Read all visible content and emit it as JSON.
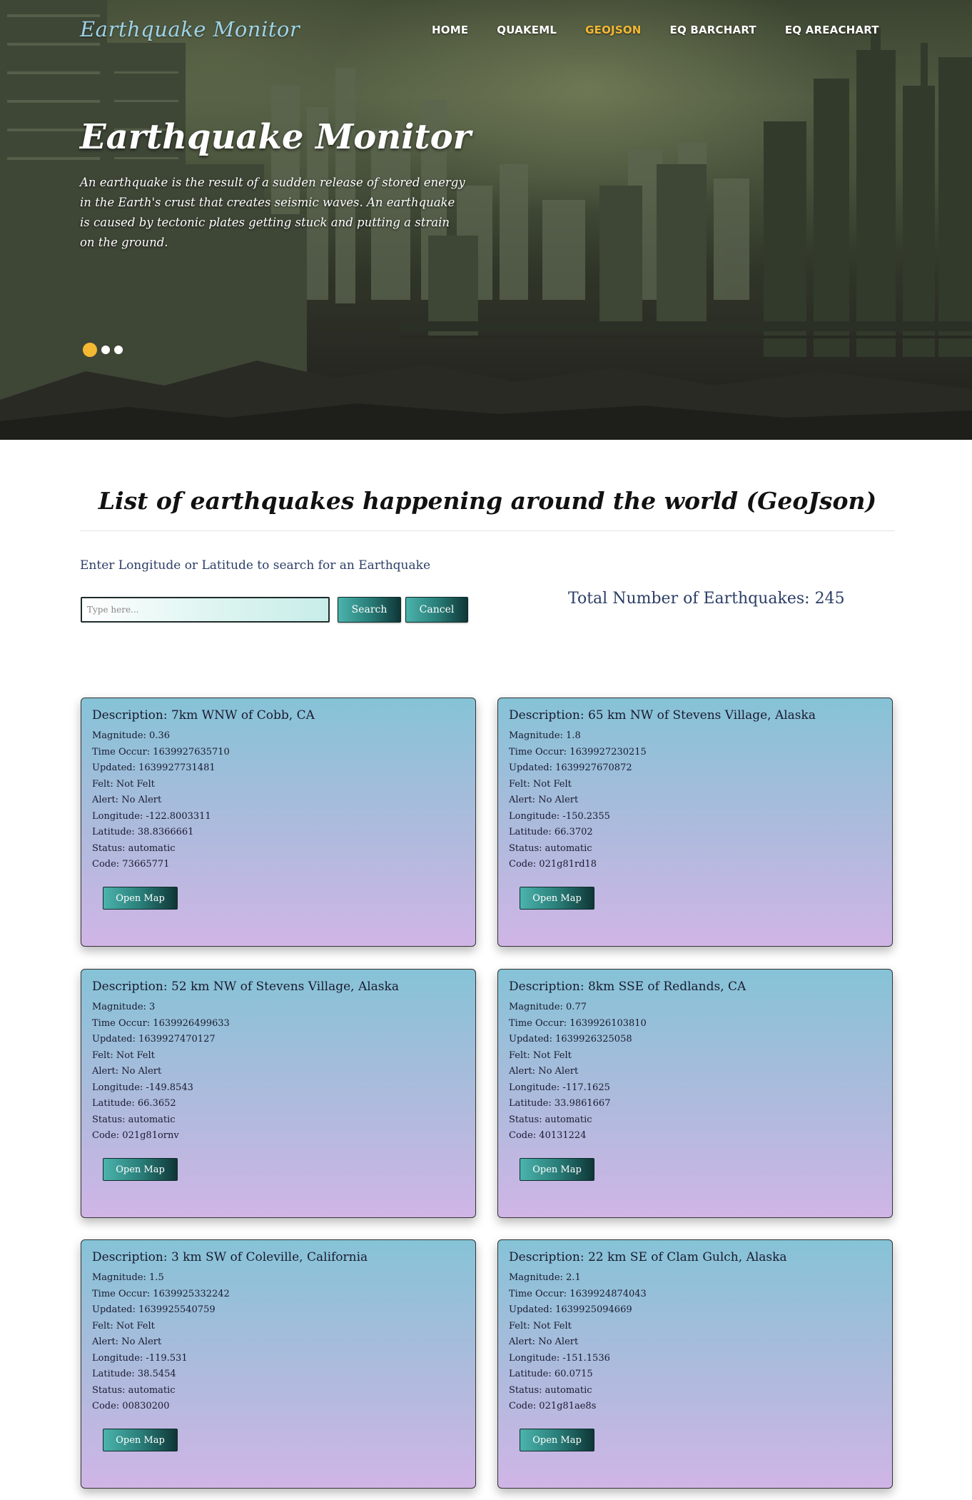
{
  "brand": "Earthquake Monitor",
  "nav": {
    "home": "HOME",
    "quakeml": "QUAKEML",
    "geojson": "GEOJSON",
    "barchart": "EQ BARCHART",
    "areachart": "EQ AREACHART"
  },
  "hero": {
    "title": "Earthquake Monitor",
    "text": "An earthquake is the result of a sudden release of stored energy in the Earth's crust that creates seismic waves. An earthquake is caused by tectonic plates getting stuck and putting a strain on the ground."
  },
  "section": {
    "title": "List of earthquakes happening around the world (GeoJson)",
    "search_hint": "Enter Longitude or Latitude to search for an Earthquake",
    "search_placeholder": "Type here...",
    "search_label": "Search",
    "cancel_label": "Cancel",
    "total": "Total Number of Earthquakes: 245"
  },
  "colors": {
    "accent": "#f5b833",
    "brand": "#9fd3e8",
    "button_start": "#4bb3ac",
    "button_end": "#0e3636"
  },
  "cards": [
    {
      "desc": "Description: 7km WNW of Cobb, CA",
      "rows": [
        "Magnitude: 0.36",
        "Time Occur: 1639927635710",
        "Updated: 1639927731481",
        "Felt: Not Felt",
        "Alert: No Alert",
        "Longitude: -122.8003311",
        "Latitude: 38.8366661",
        "Status: automatic",
        "Code: 73665771"
      ],
      "button": "Open Map"
    },
    {
      "desc": "Description: 65 km NW of Stevens Village, Alaska",
      "rows": [
        "Magnitude: 1.8",
        "Time Occur: 1639927230215",
        "Updated: 1639927670872",
        "Felt: Not Felt",
        "Alert: No Alert",
        "Longitude: -150.2355",
        "Latitude: 66.3702",
        "Status: automatic",
        "Code: 021g81rd18"
      ],
      "button": "Open Map"
    },
    {
      "desc": "Description: 52 km NW of Stevens Village, Alaska",
      "rows": [
        "Magnitude: 3",
        "Time Occur: 1639926499633",
        "Updated: 1639927470127",
        "Felt: Not Felt",
        "Alert: No Alert",
        "Longitude: -149.8543",
        "Latitude: 66.3652",
        "Status: automatic",
        "Code: 021g81ornv"
      ],
      "button": "Open Map"
    },
    {
      "desc": "Description: 8km SSE of Redlands, CA",
      "rows": [
        "Magnitude: 0.77",
        "Time Occur: 1639926103810",
        "Updated: 1639926325058",
        "Felt: Not Felt",
        "Alert: No Alert",
        "Longitude: -117.1625",
        "Latitude: 33.9861667",
        "Status: automatic",
        "Code: 40131224"
      ],
      "button": "Open Map"
    },
    {
      "desc": "Description: 3 km SW of Coleville, California",
      "rows": [
        "Magnitude: 1.5",
        "Time Occur: 1639925332242",
        "Updated: 1639925540759",
        "Felt: Not Felt",
        "Alert: No Alert",
        "Longitude: -119.531",
        "Latitude: 38.5454",
        "Status: automatic",
        "Code: 00830200"
      ],
      "button": "Open Map"
    },
    {
      "desc": "Description: 22 km SE of Clam Gulch, Alaska",
      "rows": [
        "Magnitude: 2.1",
        "Time Occur: 1639924874043",
        "Updated: 1639925094669",
        "Felt: Not Felt",
        "Alert: No Alert",
        "Longitude: -151.1536",
        "Latitude: 60.0715",
        "Status: automatic",
        "Code: 021g81ae8s"
      ],
      "button": "Open Map"
    }
  ]
}
